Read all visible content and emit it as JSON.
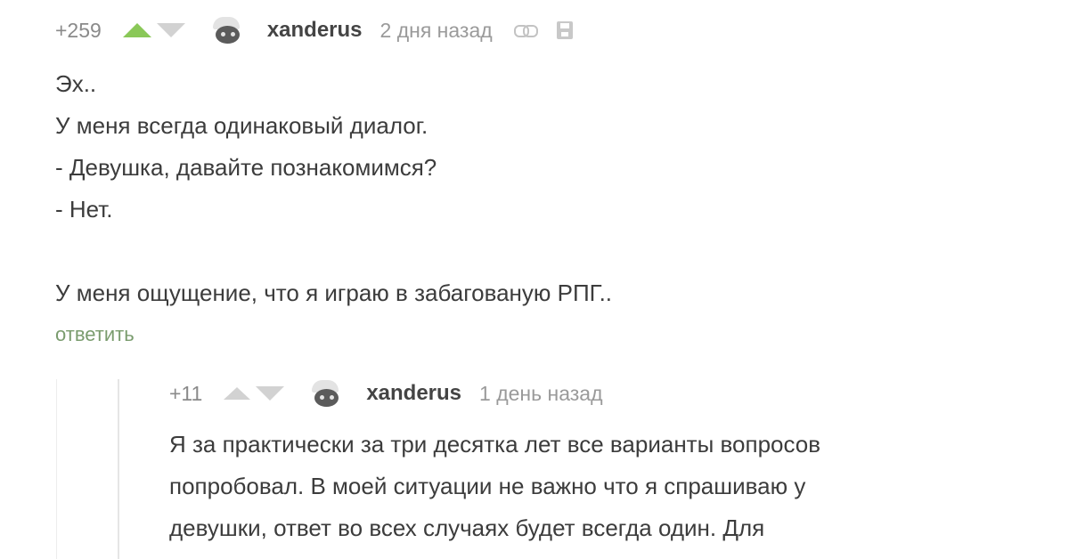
{
  "comment1": {
    "rating": "+259",
    "author": "xanderus",
    "time": "2 дня назад",
    "lines": [
      "Эх..",
      "У меня всегда одинаковый диалог.",
      "- Девушка, давайте познакомимся?",
      "- Нет.",
      "",
      "У меня ощущение, что я играю в забагованую РПГ.."
    ],
    "reply_label": "ответить"
  },
  "comment2": {
    "rating": "+11",
    "author": "xanderus",
    "time": "1 день назад",
    "lines": [
      "Я за практически за три десятка лет все варианты вопросов",
      "попробовал. В моей ситуации не важно что я спрашиваю у",
      "девушки, ответ во всех случаях будет всегда один.  Для"
    ]
  },
  "colors": {
    "upvote_active": "#8ac858",
    "vote_inactive": "#d2d2d2",
    "reply_link": "#7a9c6e"
  },
  "icons": [
    "upvote-icon",
    "downvote-icon",
    "link-icon",
    "save-icon"
  ]
}
